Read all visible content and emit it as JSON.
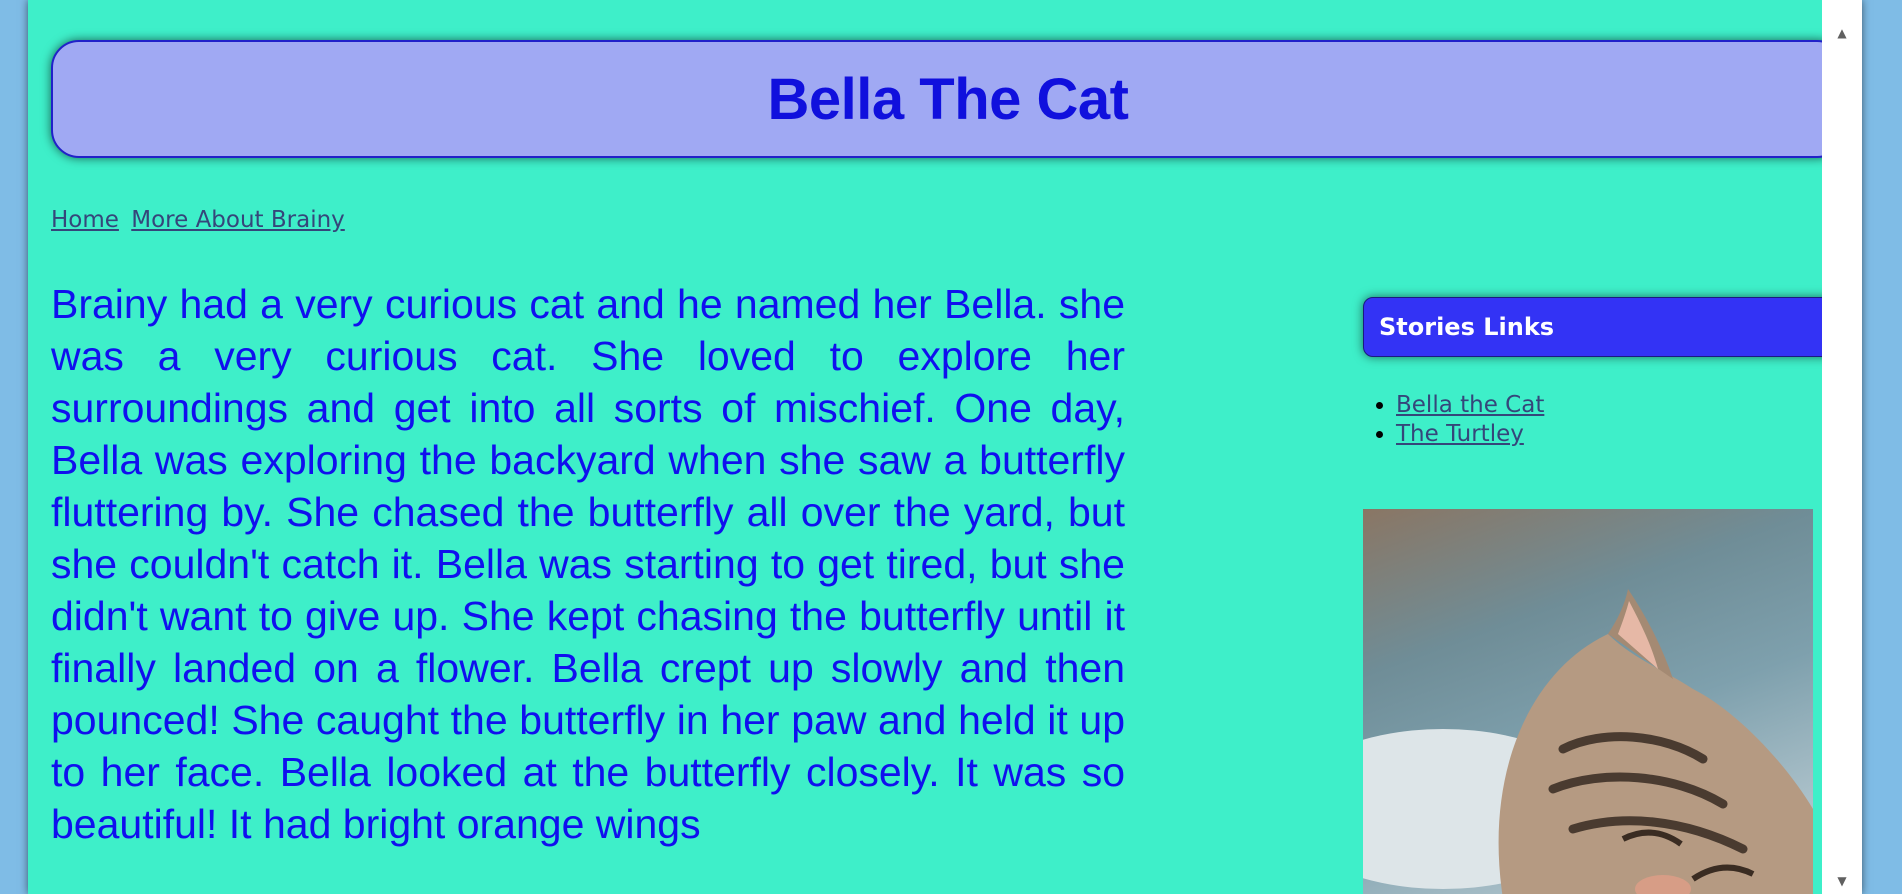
{
  "header": {
    "title": "Bella The Cat"
  },
  "nav": {
    "links": [
      "Home",
      "More About Brainy"
    ]
  },
  "story": {
    "text": "Brainy had a very curious cat and he named her Bella. she was a very curious cat. She loved to explore her surroundings and get into all sorts of mischief. One day, Bella was exploring the backyard when she saw a butterfly fluttering by. She chased the butterfly all over the yard, but she couldn't catch it. Bella was starting to get tired, but she didn't want to give up. She kept chasing the butterfly until it finally landed on a flower. Bella crept up slowly and then pounced! She caught the butterfly in her paw and held it up to her face. Bella looked at the butterfly closely. It was so beautiful! It had bright orange wings"
  },
  "sidebar": {
    "title": "Stories Links",
    "links": [
      "Bella the Cat",
      "The Turtley"
    ]
  },
  "colors": {
    "page_background": "#3eefc9",
    "outer_background": "#7fbce6",
    "header_background": "#a0a9f3",
    "title_text": "#1010dd",
    "story_text": "#1010ee",
    "sidebar_title_background": "#3333f5",
    "link_text": "#35467a"
  },
  "icons": {
    "scroll_up": "scroll-up-arrow-icon",
    "scroll_down": "scroll-down-arrow-icon"
  }
}
